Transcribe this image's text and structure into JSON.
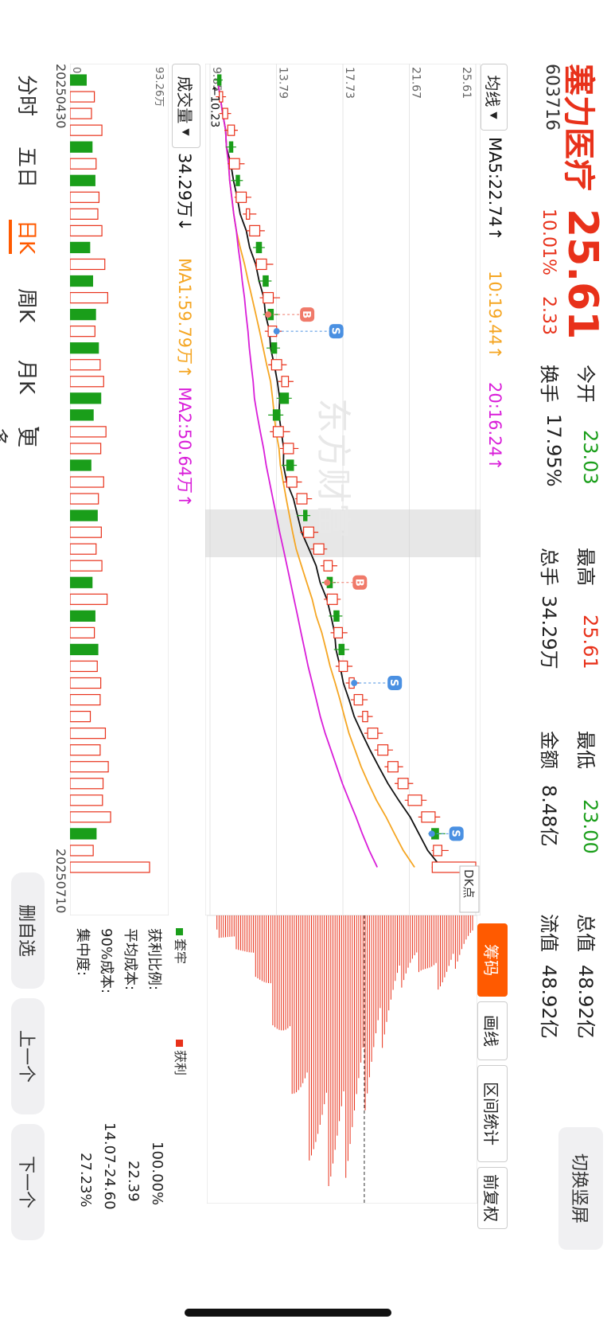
{
  "stock": {
    "name": "塞力医疗",
    "code": "603716",
    "price": "25.61",
    "change_pct": "10.01%",
    "change_amt": "2.33"
  },
  "quote": {
    "open_label": "今开",
    "open": "23.03",
    "high_label": "最高",
    "high": "25.61",
    "low_label": "最低",
    "low": "23.00",
    "total_value_label": "总值",
    "total_value": "48.92亿",
    "turnover_label": "换手",
    "turnover": "17.95%",
    "volume_label": "总手",
    "volume": "34.29万",
    "amount_label": "金额",
    "amount": "8.48亿",
    "float_value_label": "流值",
    "float_value": "48.92亿"
  },
  "switch_label": "切换竖屏",
  "ma_bar": {
    "selector": "均线",
    "ma5": "MA5:22.74↑",
    "ma10": "10:19.44↑",
    "ma20": "20:16.24↑"
  },
  "vol_bar": {
    "selector": "成交量",
    "vol": "34.29万↓",
    "ma1": "MA1:59.79万↑",
    "ma2": "MA2:50.64万↑"
  },
  "price_axis": [
    "25.61",
    "21.67",
    "17.73",
    "13.79",
    "9.85"
  ],
  "low_marker": "10.23",
  "last_marker": "25.61",
  "dk_label": "DK点",
  "vol_axis_top": "93.26万",
  "vol_axis_bottom": "0",
  "dates": {
    "start": "20250430",
    "end": "20250710"
  },
  "watermark": "东方财富",
  "chip": {
    "tabs": [
      "筹码",
      "画线",
      "区间统计",
      "前复权"
    ],
    "legend_trapped": "套牢",
    "legend_profit": "获利",
    "profit_ratio_label": "获利比例:",
    "profit_ratio": "100.00%",
    "avg_cost_label": "平均成本:",
    "avg_cost": "22.39",
    "cost90_label": "90%成本:",
    "cost90": "14.07-24.60",
    "concentration_label": "集中度:",
    "concentration": "27.23%"
  },
  "period_tabs": [
    "分时",
    "五日",
    "日K",
    "周K",
    "月K",
    "更多"
  ],
  "actions": [
    "删自选",
    "上一个",
    "下一个"
  ],
  "colors": {
    "up": "#e8311a",
    "down": "#1a9e1a",
    "ma5": "#111111",
    "ma10": "#f5a623",
    "ma20": "#d91ed9",
    "accent": "#ff5a00",
    "buy_marker": "#f07a6a",
    "sell_marker": "#4a90e2"
  },
  "chart_data": {
    "type": "candlestick",
    "x_start": "20250430",
    "x_end": "20250710",
    "ylim": [
      9.85,
      25.61
    ],
    "candles": [
      [
        10.5,
        10.3,
        10.6,
        10.1
      ],
      [
        10.4,
        10.6,
        10.8,
        10.2
      ],
      [
        10.6,
        10.9,
        11.1,
        10.4
      ],
      [
        10.9,
        11.3,
        11.5,
        10.7
      ],
      [
        11.2,
        11.0,
        11.4,
        10.8
      ],
      [
        11.0,
        11.6,
        11.9,
        10.9
      ],
      [
        11.6,
        11.4,
        11.8,
        11.1
      ],
      [
        11.4,
        12.0,
        12.3,
        11.3
      ],
      [
        12.0,
        12.2,
        12.6,
        11.8
      ],
      [
        12.2,
        12.8,
        13.1,
        12.0
      ],
      [
        12.9,
        12.6,
        13.1,
        12.4
      ],
      [
        12.6,
        13.2,
        13.6,
        12.5
      ],
      [
        13.3,
        13.0,
        13.5,
        12.7
      ],
      [
        13.0,
        13.6,
        14.0,
        12.8
      ],
      [
        13.6,
        13.3,
        13.9,
        13.0
      ],
      [
        13.3,
        13.8,
        14.1,
        13.1
      ],
      [
        13.8,
        13.5,
        14.0,
        13.2
      ],
      [
        13.5,
        14.1,
        14.4,
        13.3
      ],
      [
        14.1,
        14.5,
        14.8,
        13.9
      ],
      [
        14.5,
        14.0,
        14.7,
        13.8
      ],
      [
        14.0,
        13.6,
        14.2,
        13.3
      ],
      [
        13.6,
        14.2,
        14.6,
        13.4
      ],
      [
        14.2,
        14.8,
        15.1,
        14.0
      ],
      [
        14.8,
        14.4,
        15.0,
        14.1
      ],
      [
        14.4,
        15.0,
        15.3,
        14.2
      ],
      [
        15.0,
        15.6,
        15.9,
        14.9
      ],
      [
        15.6,
        15.4,
        15.8,
        15.0
      ],
      [
        15.4,
        16.0,
        16.3,
        15.2
      ],
      [
        16.0,
        16.6,
        16.8,
        15.8
      ],
      [
        16.6,
        17.1,
        17.4,
        16.4
      ],
      [
        17.1,
        16.8,
        17.3,
        16.5
      ],
      [
        16.8,
        17.4,
        17.6,
        16.6
      ],
      [
        17.5,
        17.2,
        17.7,
        16.9
      ],
      [
        17.2,
        17.7,
        18.0,
        17.0
      ],
      [
        17.8,
        17.5,
        18.1,
        17.2
      ],
      [
        17.5,
        18.0,
        18.3,
        17.3
      ],
      [
        18.1,
        18.4,
        18.7,
        17.9
      ],
      [
        18.4,
        18.9,
        19.2,
        18.2
      ],
      [
        18.9,
        19.2,
        19.5,
        18.6
      ],
      [
        19.2,
        19.8,
        20.1,
        19.0
      ],
      [
        19.8,
        20.4,
        20.7,
        19.6
      ],
      [
        20.4,
        21.0,
        21.3,
        20.2
      ],
      [
        21.0,
        21.6,
        21.9,
        20.8
      ],
      [
        21.6,
        22.4,
        22.7,
        21.4
      ],
      [
        22.4,
        23.2,
        23.5,
        22.2
      ],
      [
        23.4,
        23.0,
        23.8,
        22.8
      ],
      [
        23.1,
        23.6,
        24.0,
        23.0
      ],
      [
        23.03,
        25.61,
        25.61,
        23.0
      ]
    ]
  }
}
